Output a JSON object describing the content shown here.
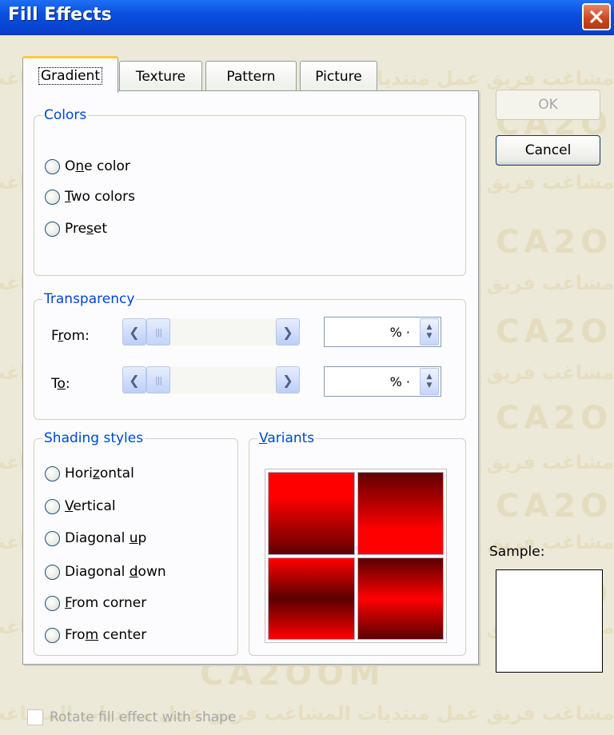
{
  "window": {
    "title": "Fill Effects",
    "close_icon": "close-icon"
  },
  "tabs": [
    {
      "label": "Gradient",
      "active": true
    },
    {
      "label": "Texture",
      "active": false
    },
    {
      "label": "Pattern",
      "active": false
    },
    {
      "label": "Picture",
      "active": false
    }
  ],
  "colors": {
    "title": "Colors",
    "options": [
      {
        "pre": "O",
        "key": "n",
        "post": "e color"
      },
      {
        "pre": "",
        "key": "T",
        "post": "wo colors"
      },
      {
        "pre": "Pre",
        "key": "s",
        "post": "et"
      }
    ]
  },
  "transparency": {
    "title": "Transparency",
    "from_label": {
      "pre": "F",
      "key": "r",
      "post": "om:"
    },
    "to_label": {
      "pre": "T",
      "key": "o",
      "post": ":"
    },
    "from_value": "% ·",
    "to_value": "% ·"
  },
  "shading": {
    "title": "Shading styles",
    "options": [
      {
        "pre": "Hori",
        "key": "z",
        "post": "ontal"
      },
      {
        "pre": "",
        "key": "V",
        "post": "ertical"
      },
      {
        "pre": "Diagonal ",
        "key": "u",
        "post": "p"
      },
      {
        "pre": "Diagonal ",
        "key": "d",
        "post": "own"
      },
      {
        "pre": "",
        "key": "F",
        "post": "rom corner"
      },
      {
        "pre": "Fro",
        "key": "m",
        "post": " center"
      }
    ]
  },
  "variants": {
    "title_pre": "",
    "title_key": "V",
    "title_post": "ariants"
  },
  "buttons": {
    "ok": "OK",
    "cancel": "Cancel"
  },
  "sample": {
    "label": "Sample:"
  },
  "rotate": {
    "label": "Rotate fill effect with shape"
  },
  "watermark": {
    "arabic": "مشاغب فريق عمل منتديات المشاغب فريق عمل منتديات المشاغب فريق عمل منتديات المشاغب",
    "latin": "CA2OOM"
  },
  "colors_palette": {
    "accent": "#0046d5",
    "titlebar": "#0a4fe0",
    "close": "#c9461f",
    "gradient_light": "#ff0000",
    "gradient_dark": "#600000"
  }
}
